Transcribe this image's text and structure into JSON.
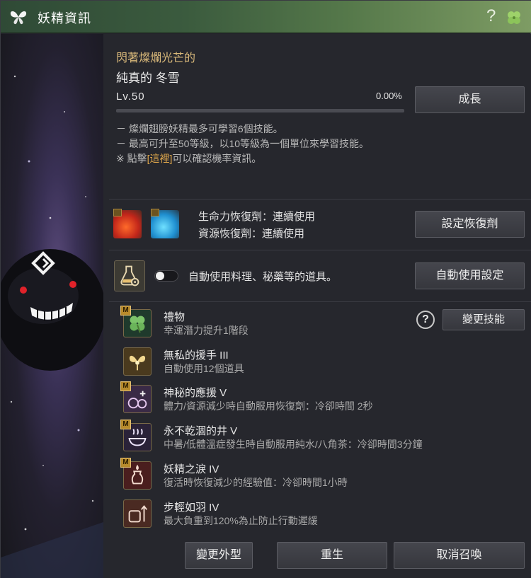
{
  "window": {
    "title": "妖精資訊"
  },
  "fairy": {
    "prefix": "閃著燦爛光芒的",
    "name": "純真的 冬雪",
    "level": "Lv.50",
    "xp_percent": "0.00%",
    "xp_fraction": 0.0
  },
  "buttons": {
    "grow": "成長",
    "recover": "設定恢復劑",
    "auto_set": "自動使用設定",
    "change_skill": "變更技能",
    "change_look": "變更外型",
    "rebirth": "重生",
    "dismiss": "取消召喚"
  },
  "notes": {
    "line1": "－ 燦爛翅膀妖精最多可學習6個技能。",
    "line2": "－ 最高可升至50等級，以10等級為一個單位來學習技能。",
    "line3_pre": "※ 點擊",
    "line3_link": "[這裡]",
    "line3_post": "可以確認機率資訊。"
  },
  "potions": {
    "hp": "生命力恢復劑：連續使用",
    "mp": "資源恢復劑：連續使用"
  },
  "auto_use": {
    "label": "自動使用料理、秘藥等的道具。",
    "enabled": false
  },
  "skills": [
    {
      "name": "禮物",
      "desc": "幸運潛力提升1階段",
      "icon": "clover-icon",
      "mastered": true
    },
    {
      "name": "無私的援手 III",
      "desc": "自動使用12個道具",
      "icon": "fairy-icon",
      "mastered": false
    },
    {
      "name": "神秘的應援 V",
      "desc": "體力/資源減少時自動服用恢復劑：冷卻時間 2秒",
      "icon": "potion-plus-icon",
      "mastered": true
    },
    {
      "name": "永不乾涸的井 V",
      "desc": "中暑/低體溫症發生時自動服用純水/八角茶：冷卻時間3分鐘",
      "icon": "bowl-icon",
      "mastered": true
    },
    {
      "name": "妖精之淚 IV",
      "desc": "復活時恢復減少的經驗值：冷卻時間1小時",
      "icon": "tear-vase-icon",
      "mastered": true
    },
    {
      "name": "步輕如羽 IV",
      "desc": "最大負重到120%為止防止行動遲緩",
      "icon": "weight-up-icon",
      "mastered": false
    }
  ],
  "colors": {
    "accent": "#d9b97a",
    "link": "#e2a94c",
    "titlebar": "#3b5b3e"
  }
}
